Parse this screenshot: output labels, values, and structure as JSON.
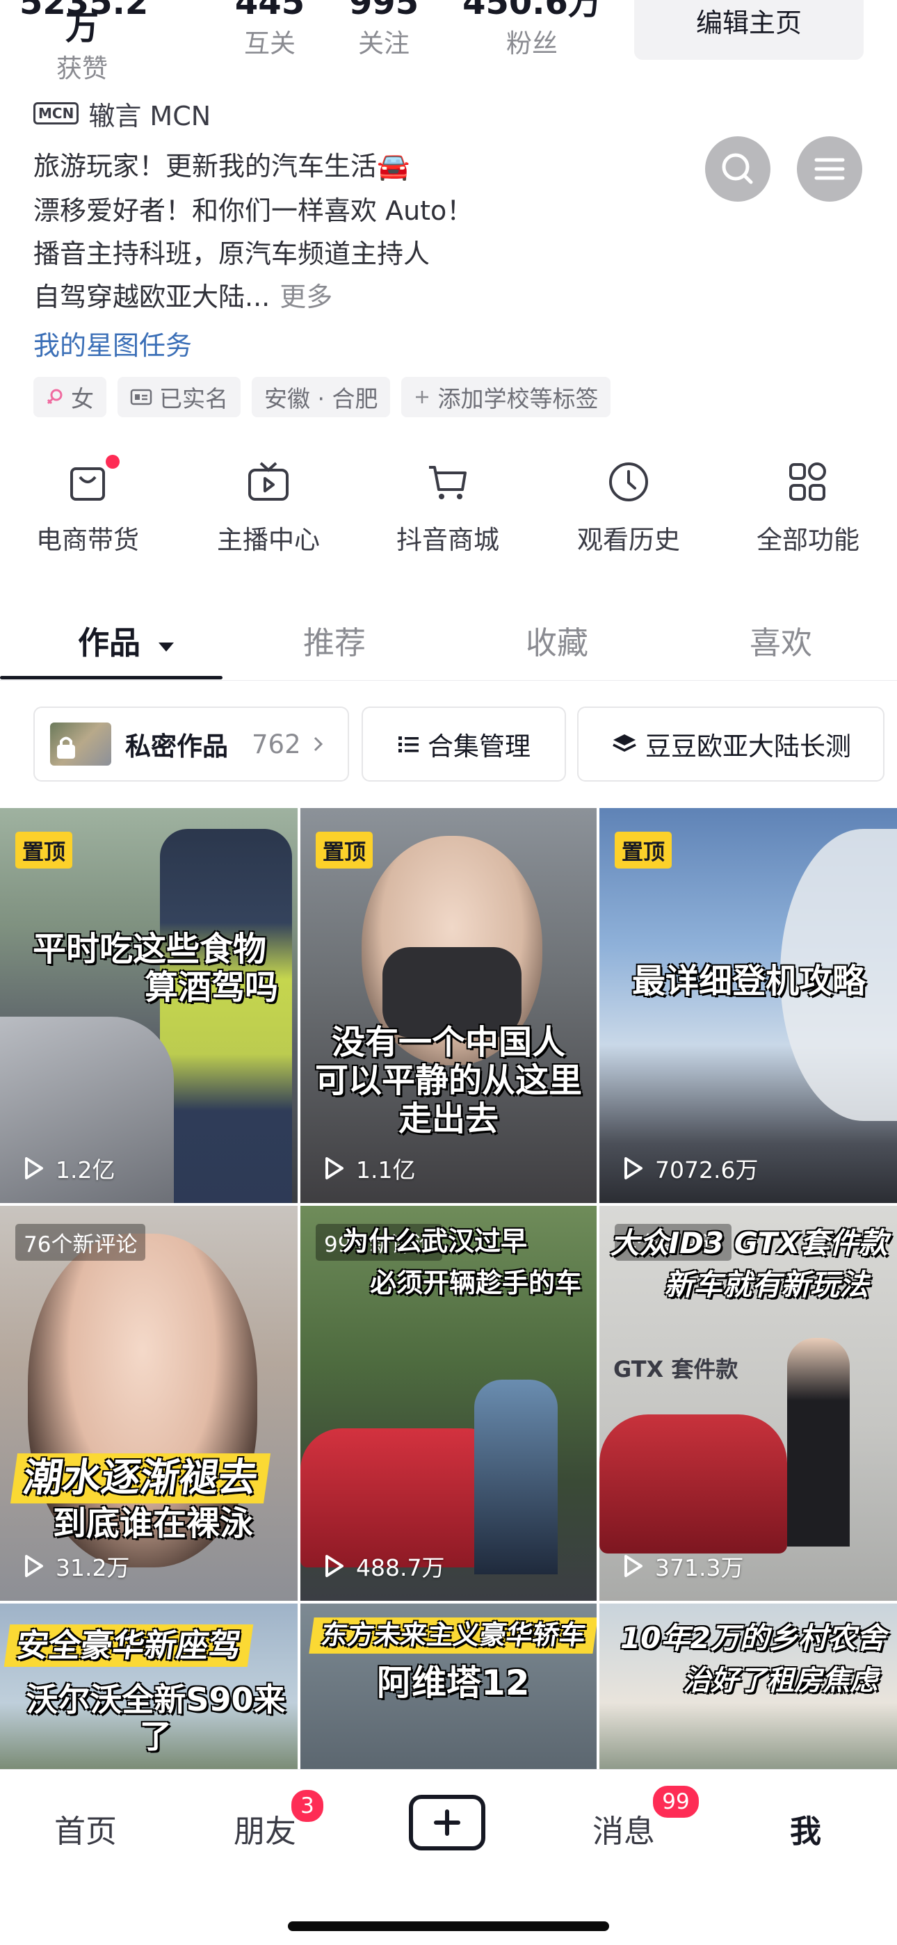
{
  "stats": [
    {
      "value": "5235.2万",
      "label": "获赞"
    },
    {
      "value": "445",
      "label": "互关"
    },
    {
      "value": "995",
      "label": "关注"
    },
    {
      "value": "450.6万",
      "label": "粉丝"
    }
  ],
  "edit_profile_label": "编辑主页",
  "mcn": {
    "badge": "MCN",
    "name": "辙言 MCN"
  },
  "bio": {
    "line1": "旅游玩家！更新我的汽车生活🚘",
    "line2": "漂移爱好者！和你们一样喜欢 Auto！",
    "line3": "播音主持科班，原汽车频道主持人",
    "line4": "自驾穿越欧亚大陆...",
    "more": "更多"
  },
  "star_task_link": "我的星图任务",
  "tags": {
    "gender": "女",
    "verified": "已实名",
    "location": "安徽 · 合肥",
    "add_school": "添加学校等标签"
  },
  "tools": [
    {
      "label": "电商带货",
      "icon": "shopping-bag-icon"
    },
    {
      "label": "主播中心",
      "icon": "live-tv-icon"
    },
    {
      "label": "抖音商城",
      "icon": "cart-icon"
    },
    {
      "label": "观看历史",
      "icon": "clock-icon"
    },
    {
      "label": "全部功能",
      "icon": "grid-icon"
    }
  ],
  "tabs": [
    "作品",
    "推荐",
    "收藏",
    "喜欢"
  ],
  "active_tab": "作品",
  "shelf": {
    "private_label": "私密作品",
    "private_count": "762",
    "collection_label": "合集管理",
    "series_label": "豆豆欧亚大陆长测"
  },
  "videos": [
    {
      "pinned": "置顶",
      "caption_l1": "平时吃这些食物",
      "caption_l2": "算酒驾吗",
      "plays": "1.2亿"
    },
    {
      "pinned": "置顶",
      "caption_l1": "没有一个中国人",
      "caption_l2": "可以平静的从这里",
      "caption_l3": "走出去",
      "plays": "1.1亿"
    },
    {
      "pinned": "置顶",
      "caption_l1": "最详细登机攻略",
      "plays": "7072.6万"
    },
    {
      "new_comments": "76个新评论",
      "caption_l1": "潮水逐渐褪去",
      "caption_l2": "到底谁在裸泳",
      "plays": "31.2万"
    },
    {
      "new_comments": "99+新评论",
      "caption_l1": "为什么武汉过早",
      "caption_l2": "必须开辆趁手的车",
      "plays": "488.7万"
    },
    {
      "new_comments": "4个新评论",
      "caption_l1": "大众ID3 GTX套件款",
      "caption_l2": "新车就有新玩法",
      "overlay": "GTX 套件款",
      "plays": "371.3万"
    },
    {
      "caption_l1": "安全豪华新座驾",
      "caption_l2": "沃尔沃全新S90来了"
    },
    {
      "caption_l1": "东方未来主义豪华轿车",
      "caption_l2": "阿维塔12"
    },
    {
      "caption_l1": "10年2万的乡村农舍",
      "caption_l2": "治好了租房焦虑"
    }
  ],
  "bottom_nav": {
    "home": "首页",
    "friends": "朋友",
    "friends_badge": "3",
    "messages": "消息",
    "messages_badge": "99",
    "me": "我"
  }
}
